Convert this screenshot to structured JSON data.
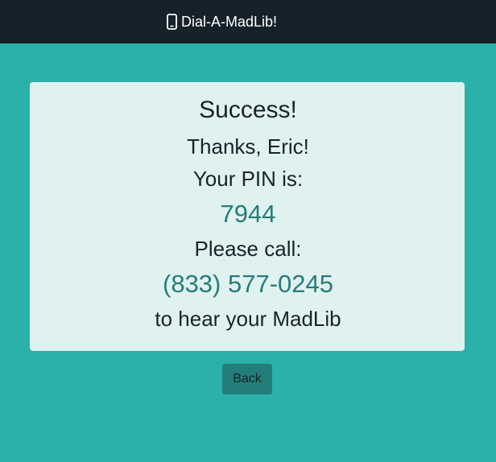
{
  "navbar": {
    "brand_icon": "mobile-phone-icon",
    "brand_text": "Dial-A-MadLib!"
  },
  "card": {
    "title": "Success!",
    "thanks": "Thanks, Eric!",
    "pin_label": "Your PIN is:",
    "pin": "7944",
    "call_label": "Please call:",
    "phone": "(833) 577-0245",
    "footer": "to hear your MadLib"
  },
  "actions": {
    "back_label": "Back"
  },
  "colors": {
    "page_background": "#2cb0aa",
    "navbar_background": "#162229",
    "card_background": "#dff2f0",
    "accent_text": "#267c78",
    "button_background": "#237e79"
  }
}
